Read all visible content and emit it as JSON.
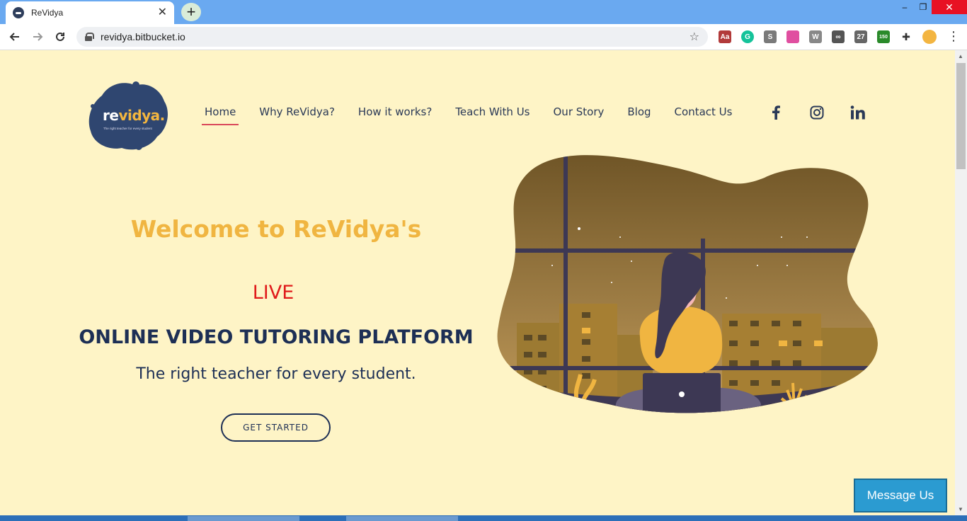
{
  "browser": {
    "tab_title": "ReVidya",
    "tab_close": "✕",
    "new_tab": "+",
    "url": "revidya.bitbucket.io",
    "window_controls": {
      "minimize": "–",
      "maximize": "❐",
      "close": "✕"
    },
    "extensions": [
      {
        "name": "acrobat-icon",
        "color": "#b23a3a",
        "label": "Aa"
      },
      {
        "name": "grammarly-icon",
        "color": "#15c39a",
        "label": "G"
      },
      {
        "name": "s-extension-icon",
        "color": "#7a7a7a",
        "label": "S"
      },
      {
        "name": "colorgrid-icon",
        "color": "#e04fa0",
        "label": ""
      },
      {
        "name": "wordpress-icon",
        "color": "#888888",
        "label": "W"
      },
      {
        "name": "glasses-icon",
        "color": "#555555",
        "label": "∞"
      },
      {
        "name": "calendar-icon",
        "color": "#666666",
        "label": "27"
      },
      {
        "name": "counter-icon",
        "color": "#2a8a2a",
        "label": "150"
      },
      {
        "name": "puzzle-icon",
        "color": "#333333",
        "label": ""
      },
      {
        "name": "profile-avatar-icon",
        "color": "#f3b541",
        "label": ""
      }
    ]
  },
  "site": {
    "logo": {
      "word_a": "re",
      "word_b": "vidya.",
      "tagline": "The right teacher for every student"
    },
    "nav": [
      {
        "label": "Home",
        "active": true
      },
      {
        "label": "Why ReVidya?"
      },
      {
        "label": "How it works?"
      },
      {
        "label": "Teach With Us"
      },
      {
        "label": "Our Story"
      },
      {
        "label": "Blog"
      },
      {
        "label": "Contact Us"
      }
    ],
    "social": [
      "facebook-icon",
      "instagram-icon",
      "linkedin-icon"
    ],
    "hero": {
      "welcome": "Welcome to ReVidya's",
      "live": "LIVE",
      "platform": "ONLINE VIDEO TUTORING PLATFORM",
      "subtitle": "The right teacher for every student.",
      "cta": "GET STARTED"
    },
    "message_button": "Message Us",
    "colors": {
      "background": "#fef4c6",
      "navy": "#1d2f55",
      "accent_yellow": "#f0b541",
      "live_red": "#e01b1b",
      "active_underline": "#d9485a",
      "message_blue": "#2b9bd1"
    }
  }
}
